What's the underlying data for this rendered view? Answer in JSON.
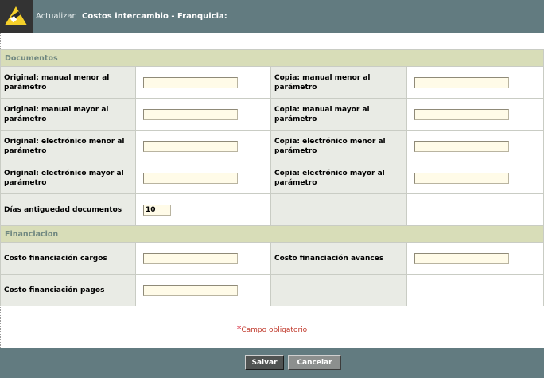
{
  "header": {
    "action_label": "Actualizar",
    "title": "Costos intercambio - Franquicia:",
    "icon": "edit-pencil-icon",
    "icon_accent": "#f5d02a"
  },
  "sections": {
    "documentos": "Documentos",
    "financiacion": "Financiacion"
  },
  "fields": {
    "original_manual_menor": {
      "label": "Original: manual menor al parámetro",
      "value": ""
    },
    "copia_manual_menor": {
      "label": "Copia: manual menor al parámetro",
      "value": ""
    },
    "original_manual_mayor": {
      "label": "Original: manual mayor al parámetro",
      "value": ""
    },
    "copia_manual_mayor": {
      "label": "Copia: manual mayor al parámetro",
      "value": ""
    },
    "original_electronico_menor": {
      "label": "Original: electrónico menor al parámetro",
      "value": ""
    },
    "copia_electronico_menor": {
      "label": "Copia: electrónico menor al parámetro",
      "value": ""
    },
    "original_electronico_mayor": {
      "label": "Original: electrónico mayor al parámetro",
      "value": ""
    },
    "copia_electronico_mayor": {
      "label": "Copia: electrónico mayor al parámetro",
      "value": ""
    },
    "dias_antiguedad": {
      "label": "Días antiguedad documentos",
      "value": "10"
    },
    "costo_fin_cargos": {
      "label": "Costo financiación cargos",
      "value": ""
    },
    "costo_fin_avances": {
      "label": "Costo financiación avances",
      "value": ""
    },
    "costo_fin_pagos": {
      "label": "Costo financiación pagos",
      "value": ""
    }
  },
  "required_note": {
    "marker": "*",
    "text": "Campo obligatorio"
  },
  "buttons": {
    "save": "Salvar",
    "cancel": "Cancelar"
  },
  "colors": {
    "header_bg": "#627b80",
    "section_bg": "#d8ddb8",
    "label_bg": "#e9ebe5",
    "input_bg": "#fffbe8",
    "required": "#d0021b"
  }
}
